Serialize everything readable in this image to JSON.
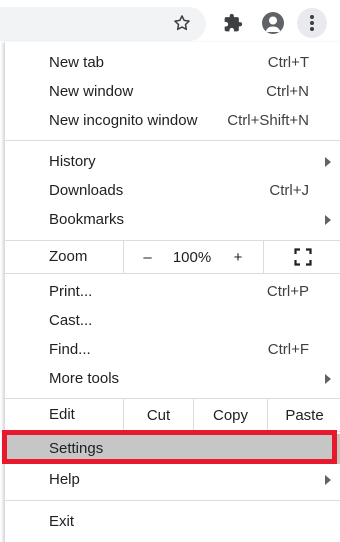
{
  "menu": {
    "new_tab": {
      "label": "New tab",
      "shortcut": "Ctrl+T"
    },
    "new_window": {
      "label": "New window",
      "shortcut": "Ctrl+N"
    },
    "new_incognito": {
      "label": "New incognito window",
      "shortcut": "Ctrl+Shift+N"
    },
    "history": {
      "label": "History"
    },
    "downloads": {
      "label": "Downloads",
      "shortcut": "Ctrl+J"
    },
    "bookmarks": {
      "label": "Bookmarks"
    },
    "zoom": {
      "label": "Zoom",
      "minus": "–",
      "level": "100%",
      "plus": "+"
    },
    "print": {
      "label": "Print...",
      "shortcut": "Ctrl+P"
    },
    "cast": {
      "label": "Cast..."
    },
    "find": {
      "label": "Find...",
      "shortcut": "Ctrl+F"
    },
    "more_tools": {
      "label": "More tools"
    },
    "edit": {
      "label": "Edit",
      "cut": "Cut",
      "copy": "Copy",
      "paste": "Paste"
    },
    "settings": {
      "label": "Settings"
    },
    "help": {
      "label": "Help"
    },
    "exit": {
      "label": "Exit"
    }
  },
  "toolbar": {
    "icons": [
      "star-icon",
      "extensions-icon",
      "profile-icon",
      "more-menu-icon"
    ]
  },
  "colors": {
    "highlight": "#c6c6c6",
    "annotation_box": "#e8192c"
  }
}
